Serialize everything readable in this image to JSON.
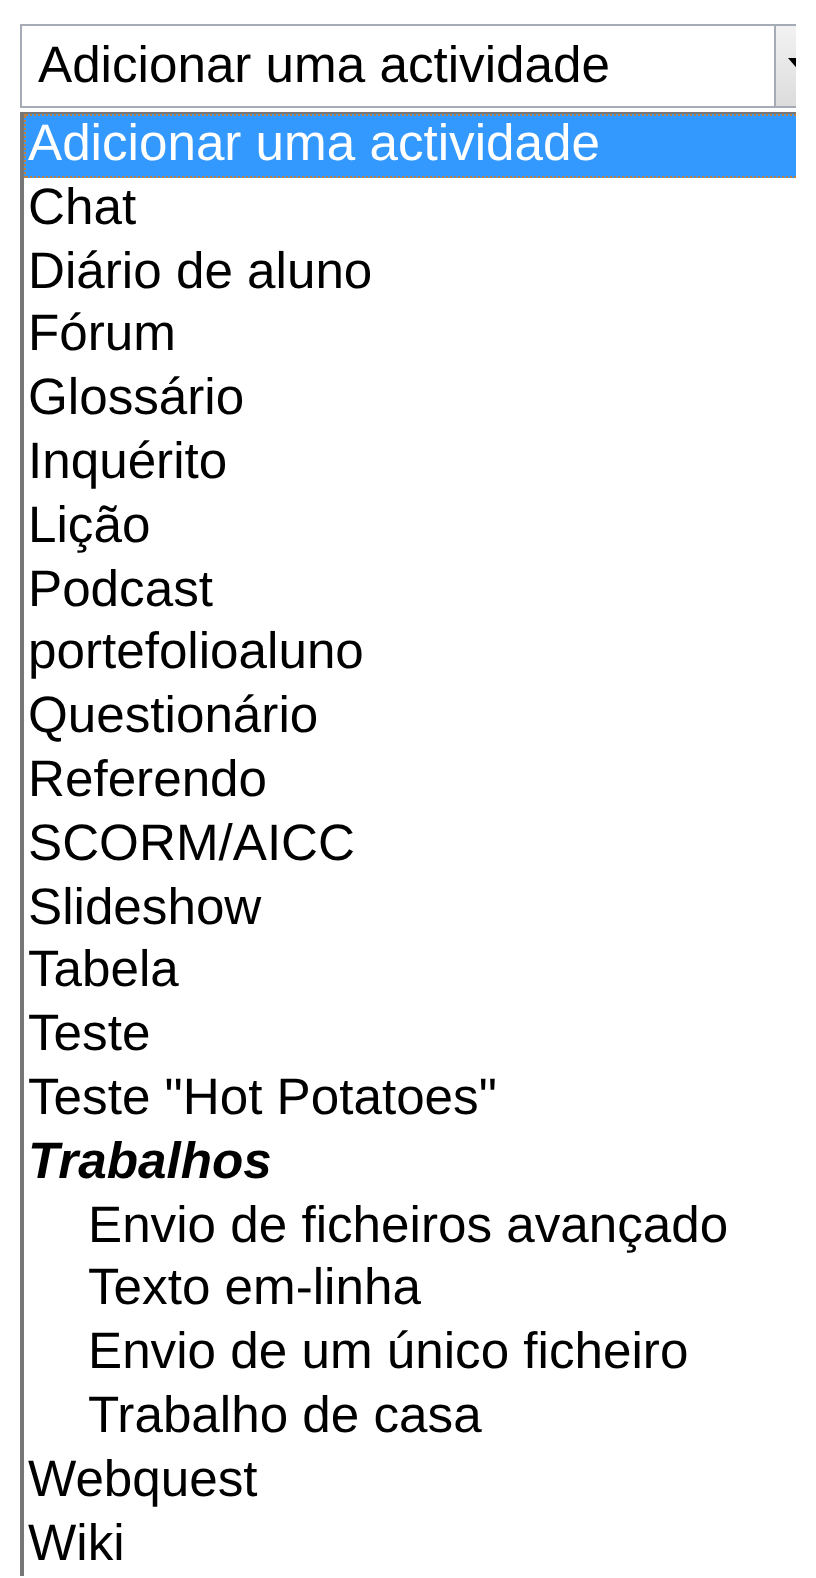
{
  "select": {
    "value": "Adicionar uma actividade"
  },
  "options": [
    {
      "kind": "option",
      "label": "Adicionar uma actividade",
      "selected": true
    },
    {
      "kind": "option",
      "label": "Chat",
      "selected": false
    },
    {
      "kind": "option",
      "label": "Diário de aluno",
      "selected": false
    },
    {
      "kind": "option",
      "label": "Fórum",
      "selected": false
    },
    {
      "kind": "option",
      "label": "Glossário",
      "selected": false
    },
    {
      "kind": "option",
      "label": "Inquérito",
      "selected": false
    },
    {
      "kind": "option",
      "label": "Lição",
      "selected": false
    },
    {
      "kind": "option",
      "label": "Podcast",
      "selected": false
    },
    {
      "kind": "option",
      "label": "portefolioaluno",
      "selected": false
    },
    {
      "kind": "option",
      "label": "Questionário",
      "selected": false
    },
    {
      "kind": "option",
      "label": "Referendo",
      "selected": false
    },
    {
      "kind": "option",
      "label": "SCORM/AICC",
      "selected": false
    },
    {
      "kind": "option",
      "label": "Slideshow",
      "selected": false
    },
    {
      "kind": "option",
      "label": "Tabela",
      "selected": false
    },
    {
      "kind": "option",
      "label": "Teste",
      "selected": false
    },
    {
      "kind": "option",
      "label": "Teste \"Hot Potatoes\"",
      "selected": false
    },
    {
      "kind": "group",
      "label": "Trabalhos",
      "children": [
        {
          "label": "Envio de ficheiros avançado",
          "selected": false
        },
        {
          "label": "Texto em-linha",
          "selected": false
        },
        {
          "label": "Envio de um único ficheiro",
          "selected": false
        },
        {
          "label": "Trabalho de casa",
          "selected": false
        }
      ]
    },
    {
      "kind": "option",
      "label": "Webquest",
      "selected": false
    },
    {
      "kind": "option",
      "label": "Wiki",
      "selected": false
    }
  ]
}
